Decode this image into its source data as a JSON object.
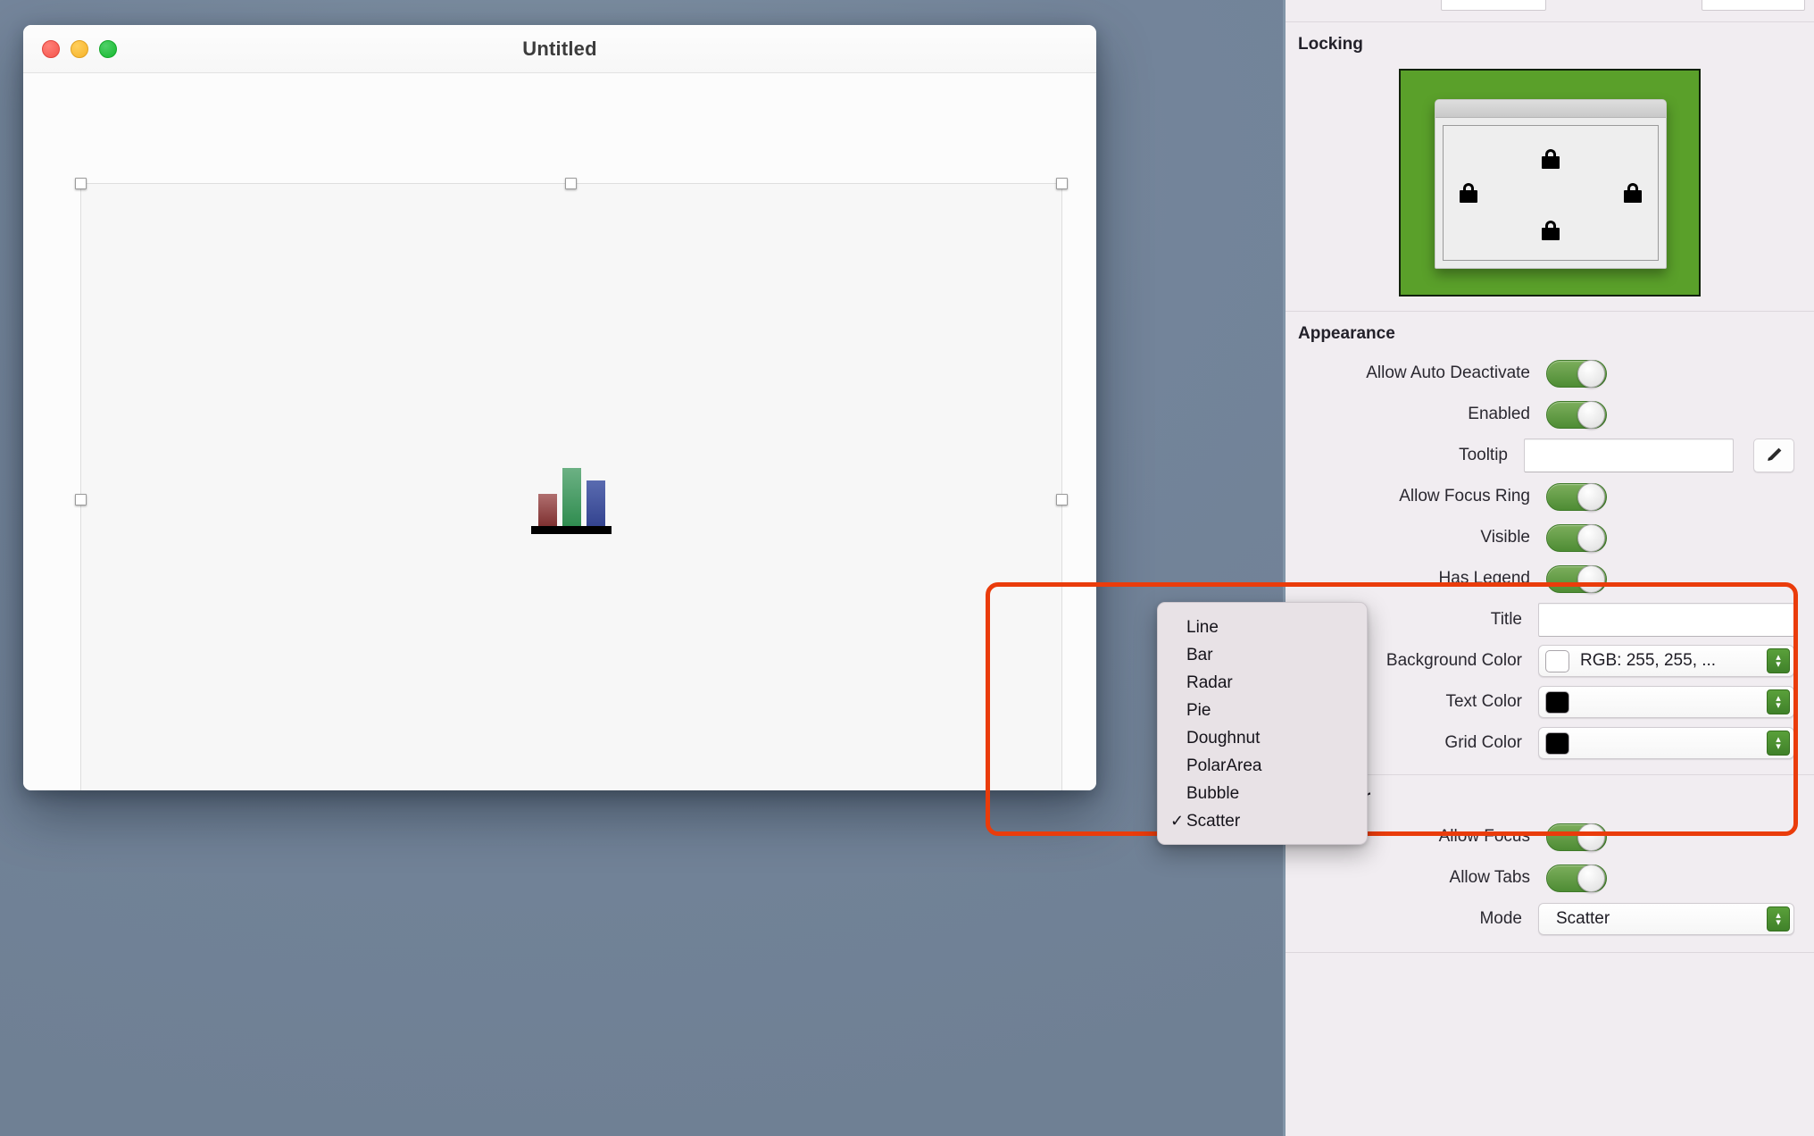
{
  "desktop": {
    "background_color": "#73849a"
  },
  "document_window": {
    "title": "Untitled",
    "traffic_lights": [
      {
        "name": "close",
        "color": "#f4554c"
      },
      {
        "name": "minimize",
        "color": "#f6b32a"
      },
      {
        "name": "zoom",
        "color": "#16b92f"
      }
    ],
    "canvas": {
      "selected_object": "chart-view",
      "chart_icon": {
        "bars": [
          {
            "color_top": "#b06f6f",
            "color_bottom": "#7d2f2f",
            "height_pct": 56
          },
          {
            "color_top": "#6cb184",
            "color_bottom": "#2f8c4f",
            "height_pct": 100
          },
          {
            "color_top": "#5a6bb0",
            "color_bottom": "#33438f",
            "height_pct": 78
          }
        ]
      }
    }
  },
  "inspector": {
    "sections": [
      {
        "name": "locking",
        "title": "Locking",
        "preview": {
          "frame_color": "#5aa02a",
          "locks": [
            "lock-top-icon",
            "lock-left-icon",
            "lock-right-icon",
            "lock-bottom-icon"
          ]
        }
      },
      {
        "name": "appearance",
        "title": "Appearance",
        "rows": [
          {
            "label": "Allow Auto Deactivate",
            "control": "toggle",
            "value": "on"
          },
          {
            "label": "Enabled",
            "control": "toggle",
            "value": "on"
          },
          {
            "label": "Tooltip",
            "control": "textfield",
            "value": "",
            "placeholder": "",
            "has_edit_button": true
          },
          {
            "label": "Allow Focus Ring",
            "control": "toggle",
            "value": "on"
          },
          {
            "label": "Visible",
            "control": "toggle",
            "value": "on"
          },
          {
            "label": "Has Legend",
            "control": "toggle",
            "value": "on"
          },
          {
            "label": "Title",
            "control": "textfield",
            "value": "",
            "placeholder": ""
          },
          {
            "label": "Background Color",
            "control": "color-popup",
            "value": "RGB: 255, 255, ...",
            "swatch": "#ffffff"
          },
          {
            "label": "Text Color",
            "control": "color-popup",
            "value": "",
            "swatch": "#000000"
          },
          {
            "label": "Grid Color",
            "control": "color-popup",
            "value": "",
            "swatch": "#000000"
          }
        ]
      },
      {
        "name": "behavior",
        "title": "Behavior",
        "rows": [
          {
            "label": "Allow Focus",
            "control": "toggle",
            "value": "on"
          },
          {
            "label": "Allow Tabs",
            "control": "toggle",
            "value": "on"
          },
          {
            "label": "Mode",
            "control": "popup",
            "value": "Scatter"
          }
        ]
      }
    ],
    "accent_green": "#4e8c34",
    "highlight_color": "#ea3c0b"
  },
  "dropdown": {
    "name": "chart-mode-menu",
    "selected": "Scatter",
    "checkmark": "✓",
    "items": [
      {
        "label": "Line",
        "checked": false
      },
      {
        "label": "Bar",
        "checked": false
      },
      {
        "label": "Radar",
        "checked": false
      },
      {
        "label": "Pie",
        "checked": false
      },
      {
        "label": "Doughnut",
        "checked": false
      },
      {
        "label": "PolarArea",
        "checked": false
      },
      {
        "label": "Bubble",
        "checked": false
      },
      {
        "label": "Scatter",
        "checked": true
      }
    ]
  },
  "labels": {
    "stepper_up": "▴",
    "stepper_down": "▾"
  }
}
